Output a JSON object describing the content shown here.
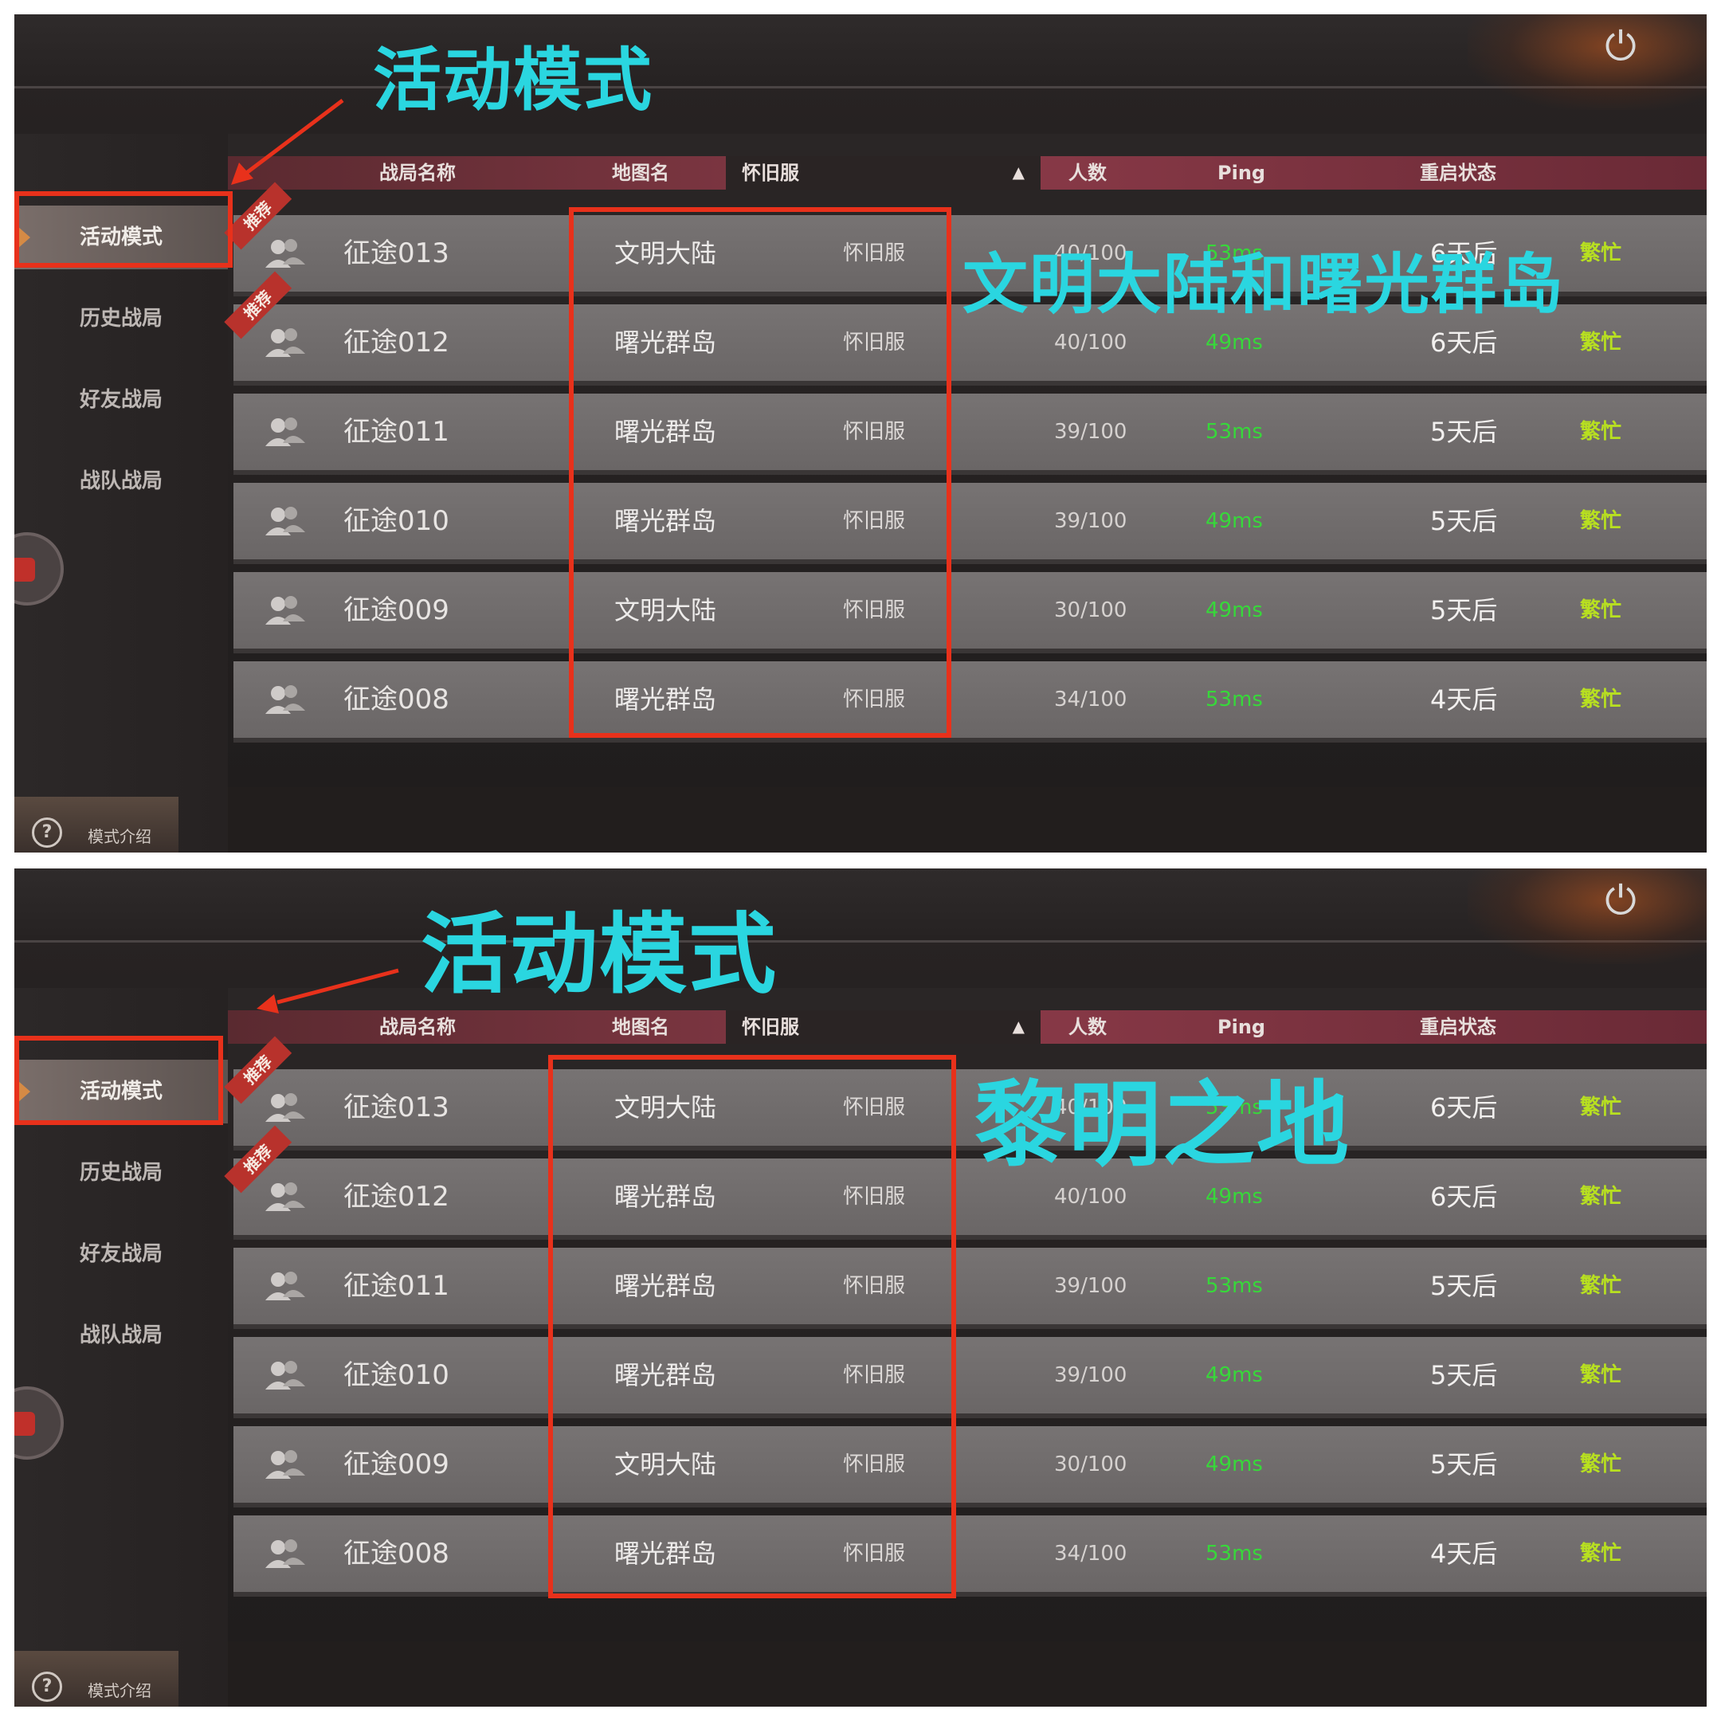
{
  "annotation": {
    "mode_label": "活动模式",
    "top_callout": "文明大陆和曙光群岛",
    "bottom_callout": "黎明之地"
  },
  "sidebar": {
    "items": [
      "活动模式",
      "历史战局",
      "好友战局",
      "战队战局"
    ],
    "mode_intro": "模式介绍",
    "help_glyph": "?"
  },
  "header": {
    "name": "战局名称",
    "map": "地图名",
    "filter": "怀旧服",
    "count": "人数",
    "ping": "Ping",
    "restart": "重启状态"
  },
  "recommend_tag": "推荐",
  "power_glyph": "⏻",
  "rows": [
    {
      "name": "征途013",
      "map": "文明大陆",
      "server": "怀旧服",
      "count": "40/100",
      "ping": "53ms",
      "restart": "6天后",
      "status": "繁忙",
      "recommended": true
    },
    {
      "name": "征途012",
      "map": "曙光群岛",
      "server": "怀旧服",
      "count": "40/100",
      "ping": "49ms",
      "restart": "6天后",
      "status": "繁忙",
      "recommended": true
    },
    {
      "name": "征途011",
      "map": "曙光群岛",
      "server": "怀旧服",
      "count": "39/100",
      "ping": "53ms",
      "restart": "5天后",
      "status": "繁忙",
      "recommended": false
    },
    {
      "name": "征途010",
      "map": "曙光群岛",
      "server": "怀旧服",
      "count": "39/100",
      "ping": "49ms",
      "restart": "5天后",
      "status": "繁忙",
      "recommended": false
    },
    {
      "name": "征途009",
      "map": "文明大陆",
      "server": "怀旧服",
      "count": "30/100",
      "ping": "49ms",
      "restart": "5天后",
      "status": "繁忙",
      "recommended": false
    },
    {
      "name": "征途008",
      "map": "曙光群岛",
      "server": "怀旧服",
      "count": "34/100",
      "ping": "53ms",
      "restart": "4天后",
      "status": "繁忙",
      "recommended": false
    }
  ],
  "colors": {
    "annotation_cyan": "#2ad6e0",
    "highlight_red": "#e8311b",
    "ping_green": "#37d83a",
    "status_yellow_green": "#b8e020"
  }
}
